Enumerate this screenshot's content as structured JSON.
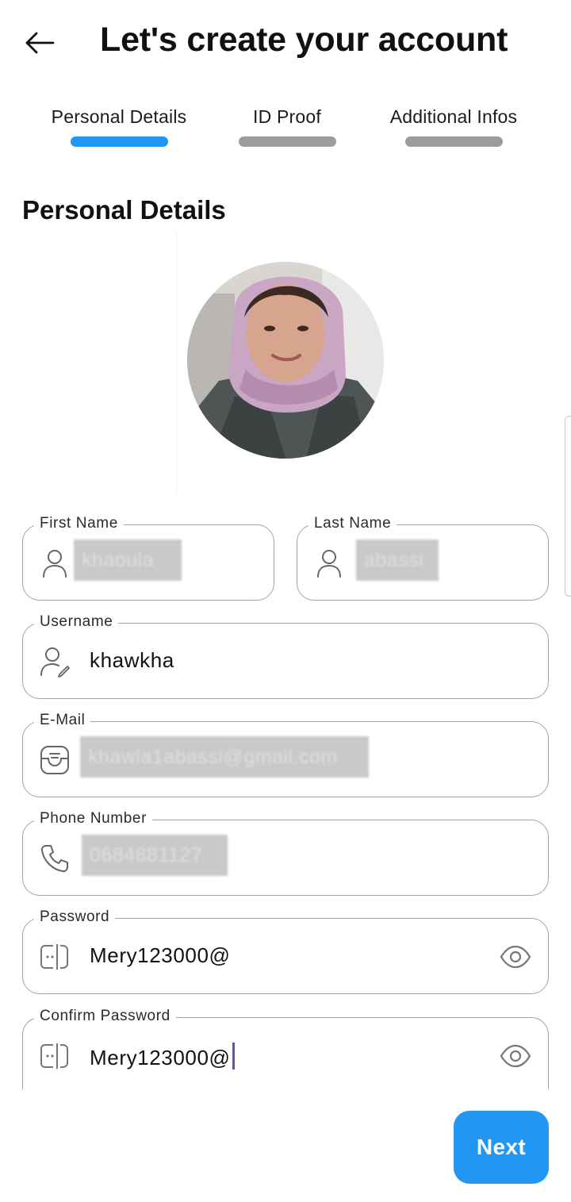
{
  "header": {
    "title": "Let's create your account",
    "back_icon": "arrow-left-icon"
  },
  "steps": [
    {
      "label": "Personal Details",
      "active": true
    },
    {
      "label": "ID Proof",
      "active": false
    },
    {
      "label": "Additional Infos",
      "active": false
    }
  ],
  "section": {
    "title": "Personal Details",
    "avatar": "profile-photo"
  },
  "fields": {
    "first_name": {
      "label": "First Name",
      "value": "khaoula",
      "icon": "person-icon",
      "redacted": true
    },
    "last_name": {
      "label": "Last Name",
      "value": "abassi",
      "icon": "person-icon",
      "redacted": true
    },
    "username": {
      "label": "Username",
      "value": "khawkha",
      "icon": "person-edit-icon"
    },
    "email": {
      "label": "E-Mail",
      "value": "khawla1abassi@gmail.com",
      "icon": "mail-icon",
      "redacted": true
    },
    "phone": {
      "label": "Phone Number",
      "value": "0684881127",
      "icon": "phone-icon",
      "redacted": true
    },
    "password": {
      "label": "Password",
      "value": "Mery123000@",
      "icon": "password-icon",
      "toggle_icon": "eye-icon"
    },
    "confirm_password": {
      "label": "Confirm Password",
      "value": "Mery123000@",
      "icon": "password-icon",
      "toggle_icon": "eye-icon"
    }
  },
  "actions": {
    "next_label": "Next"
  },
  "colors": {
    "accent": "#2196f3",
    "inactive_step": "#9c9c9c",
    "border": "#a4a4a4"
  }
}
